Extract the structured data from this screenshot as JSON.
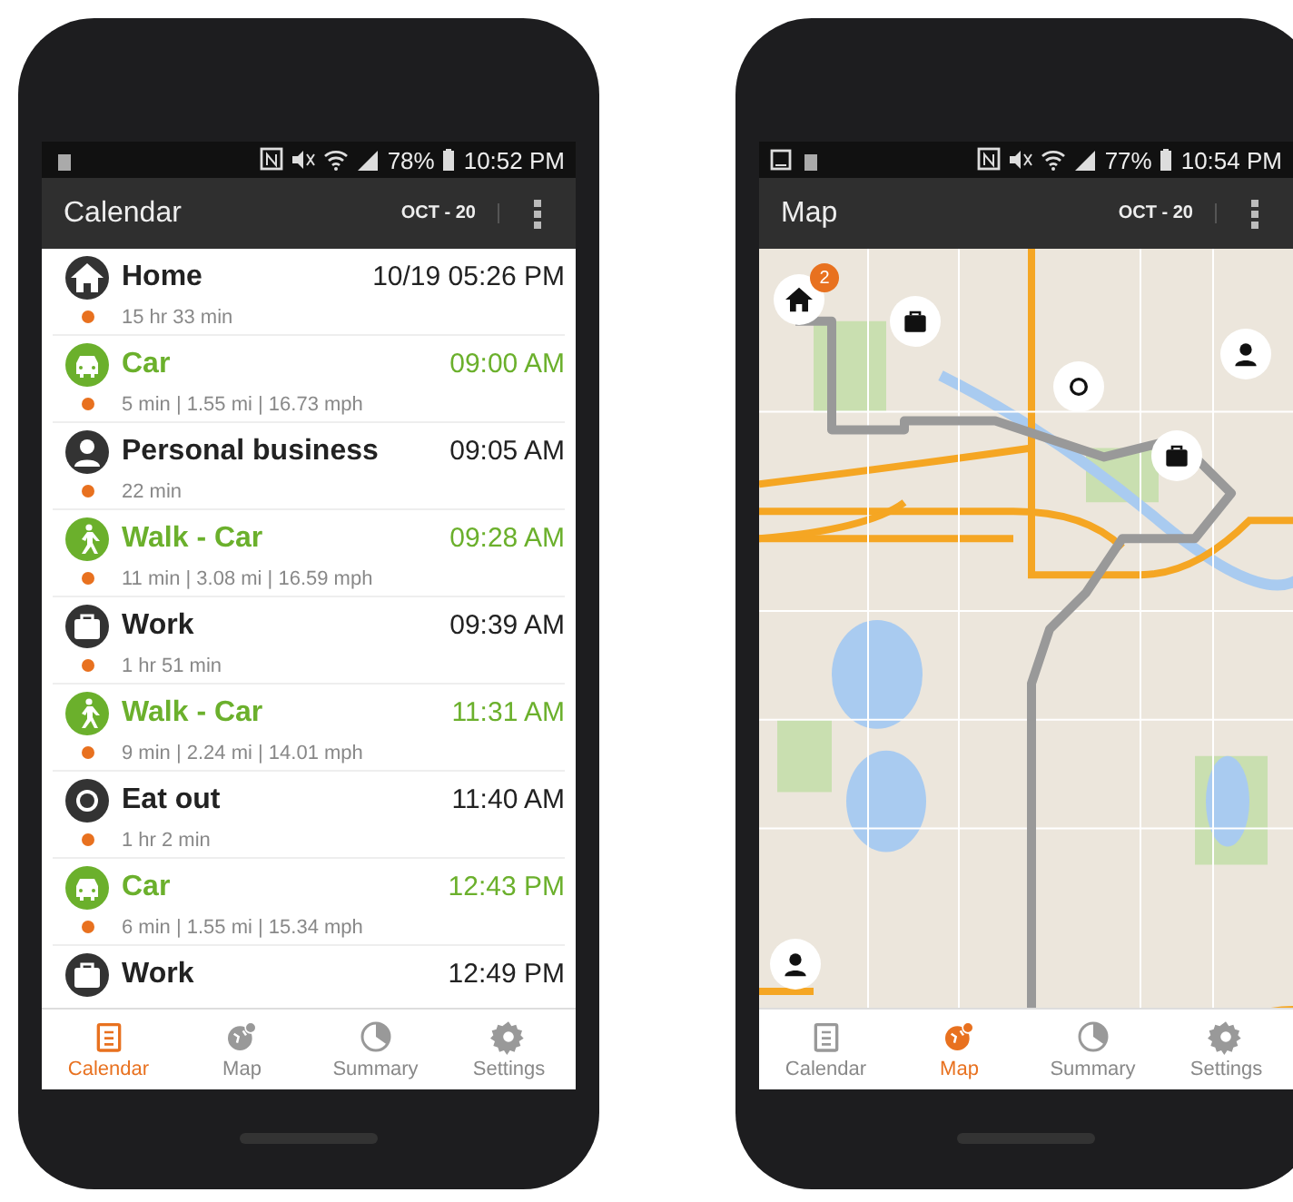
{
  "phones": [
    {
      "status_bar": {
        "battery": "78%",
        "time": "10:52 PM",
        "image_notice": false
      },
      "app_bar": {
        "title": "Calendar",
        "date": "OCT - 20"
      },
      "content": {
        "kind": "list",
        "entries": [
          {
            "kind": "home",
            "title": "Home",
            "time": "10/19 05:26 PM",
            "detail": "15 hr 33 min"
          },
          {
            "kind": "car",
            "title": "Car",
            "time": "09:00 AM",
            "detail": "5 min | 1.55 mi | 16.73 mph"
          },
          {
            "kind": "person",
            "title": "Personal business",
            "time": "09:05 AM",
            "detail": "22 min"
          },
          {
            "kind": "walk",
            "title": "Walk - Car",
            "time": "09:28 AM",
            "detail": "11 min | 3.08 mi | 16.59 mph"
          },
          {
            "kind": "work",
            "title": "Work",
            "time": "09:39 AM",
            "detail": "1 hr 51 min"
          },
          {
            "kind": "walk",
            "title": "Walk - Car",
            "time": "11:31 AM",
            "detail": "9 min | 2.24 mi | 14.01 mph"
          },
          {
            "kind": "eat",
            "title": "Eat out",
            "time": "11:40 AM",
            "detail": "1 hr 2 min"
          },
          {
            "kind": "car",
            "title": "Car",
            "time": "12:43 PM",
            "detail": "6 min | 1.55 mi | 15.34 mph"
          },
          {
            "kind": "work",
            "title": "Work",
            "time": "12:49 PM"
          }
        ]
      },
      "nav": [
        {
          "label": "Calendar",
          "selected": true
        },
        {
          "label": "Map",
          "selected": false
        },
        {
          "label": "Summary",
          "selected": false
        },
        {
          "label": "Settings",
          "selected": false
        }
      ]
    },
    {
      "status_bar": {
        "battery": "77%",
        "time": "10:54 PM",
        "image_notice": true
      },
      "app_bar": {
        "title": "Map",
        "date": "OCT - 20"
      },
      "content": {
        "kind": "map",
        "markers": [
          {
            "kind": "home",
            "badge": "2"
          },
          {
            "kind": "work"
          },
          {
            "kind": "eat"
          },
          {
            "kind": "person"
          },
          {
            "kind": "work"
          },
          {
            "kind": "person"
          }
        ]
      },
      "nav": [
        {
          "label": "Calendar",
          "selected": false
        },
        {
          "label": "Map",
          "selected": true
        },
        {
          "label": "Summary",
          "selected": false
        },
        {
          "label": "Settings",
          "selected": false
        }
      ]
    }
  ]
}
